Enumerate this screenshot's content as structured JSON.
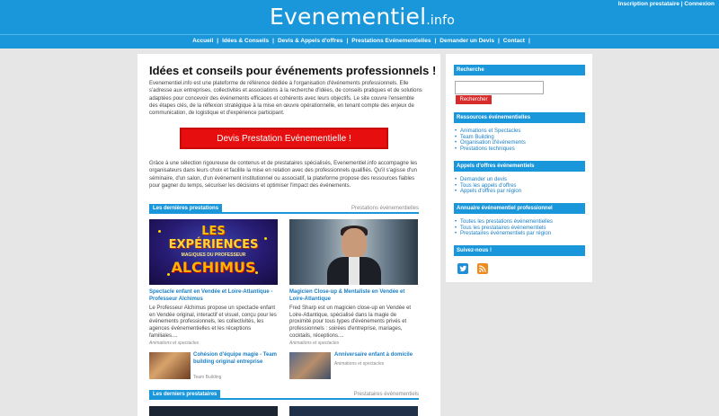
{
  "header": {
    "logo_main": "Evenementiel",
    "logo_tld": ".info",
    "top_links": "Inscription prestataire | Connexion"
  },
  "nav": {
    "items": [
      "Accueil",
      "Idées & Conseils",
      "Devis & Appels d'offres",
      "Prestations Evénementielles",
      "Demander un Devis",
      "Contact"
    ],
    "separator": "|"
  },
  "main": {
    "title": "Idées et conseils pour événements professionnels !",
    "intro": "Evenementiel.info est une plateforme de référence dédiée à l'organisation d'événements professionnels. Elle s'adresse aux entreprises, collectivités et associations à la recherche d'idées, de conseils pratiques et de solutions adaptées pour concevoir des événements efficaces et cohérents avec leurs objectifs. Le site couvre l'ensemble des étapes clés, de la réflexion stratégique à la mise en œuvre opérationnelle, en tenant compte des enjeux de communication, de logistique et d'expérience participant.",
    "cta": "Devis Prestation Evénementielle !",
    "body": "Grâce à une sélection rigoureuse de contenus et de prestataires spécialisés, Evenementiel.info accompagne les organisateurs dans leurs choix et facilite la mise en relation avec des professionnels qualifiés. Qu'il s'agisse d'un séminaire, d'un salon, d'un événement institutionnel ou associatif, la plateforme propose des ressources fiables pour gagner du temps, sécuriser les décisions et optimiser l'impact des événements.",
    "section1": {
      "tab": "Les dernières prestations",
      "link": "Prestations événementielles"
    },
    "cards": [
      {
        "image_lines": [
          "LES",
          "EXPÉRIENCES",
          "MAGIQUES DU PROFESSEUR",
          "ALCHIMUS"
        ],
        "title": "Spectacle enfant en Vendée et Loire-Atlantique - Professeur Alchimus",
        "text": "Le Professeur Alchimus propose un spectacle enfant en Vendée original, interactif et visuel, conçu pour les événements professionnels, les collectivités, les agences événementielles et les réceptions familiales....",
        "category": "Animations et spectacles"
      },
      {
        "title": "Magicien Close-up & Mentaliste en Vendée et Loire-Atlantique",
        "text": "Fred Sharp est un magicien close-up en Vendée et Loire-Atlantique, spécialisé dans la magie de proximité pour tous types d'événements privés et professionnels : soirées d'entreprise, mariages, cocktails, réceptions....",
        "category": "Animations et spectacles"
      }
    ],
    "small_cards": [
      {
        "title": "Cohésion d'équipe magie - Team building original entreprise",
        "category": "Team Building"
      },
      {
        "title": "Anniversaire enfant à domicile",
        "category": "Animations et spectacles"
      }
    ],
    "section2": {
      "tab": "Les derniers prestataires",
      "link": "Prestataires événementiels"
    }
  },
  "sidebar": {
    "search_head": "Recherche",
    "search_button": "Rechercher",
    "resources_head": "Ressources événementielles",
    "resources": [
      "Animations et Spectacles",
      "Team Building",
      "Organisation d'événements",
      "Prestations techniques"
    ],
    "tenders_head": "Appels d'offres événementiels",
    "tenders": [
      "Demander un devis",
      "Tous les appels d'offres",
      "Appels d'offres par région"
    ],
    "directory_head": "Annuaire événementiel professionnel",
    "directory": [
      "Toutes les prestations événementielles",
      "Tous les prestataires événementiels",
      "Prestataires événementiels par région"
    ],
    "follow_head": "Suivez-nous !"
  },
  "colors": {
    "brand": "#1a97db",
    "cta": "#e60e0e",
    "link": "#1a7fc4",
    "background": "#e6e6e6"
  },
  "icons": [
    "twitter-icon",
    "rss-icon"
  ]
}
